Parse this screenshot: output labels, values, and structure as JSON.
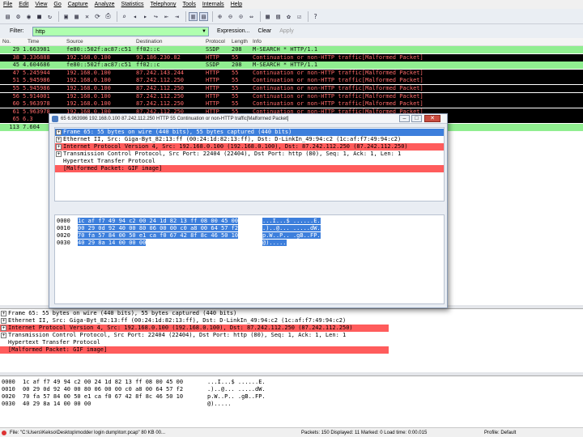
{
  "menu": [
    "File",
    "Edit",
    "View",
    "Go",
    "Capture",
    "Analyze",
    "Statistics",
    "Telephony",
    "Tools",
    "Internals",
    "Help"
  ],
  "toolbar_icons": [
    "interface-list-icon",
    "capture-options-icon",
    "start-capture-icon",
    "stop-capture-icon",
    "restart-capture-icon",
    "sep",
    "open-file-icon",
    "save-file-icon",
    "close-file-icon",
    "reload-icon",
    "print-icon",
    "sep",
    "find-icon",
    "go-back-icon",
    "go-forward-icon",
    "go-to-packet-icon",
    "first-packet-icon",
    "last-packet-icon",
    "sep",
    "colorize-icon",
    "auto-scroll-icon",
    "sep",
    "zoom-in-icon",
    "zoom-out-icon",
    "zoom-normal-icon",
    "resize-columns-icon",
    "sep",
    "capture-filters-icon",
    "display-filters-icon",
    "coloring-rules-icon",
    "preferences-icon",
    "sep",
    "help-icon"
  ],
  "filter": {
    "label": "Filter:",
    "value": "http",
    "expression_label": "Expression...",
    "clear_label": "Clear",
    "apply_label": "Apply"
  },
  "columns": [
    "No.",
    "Time",
    "Source",
    "Destination",
    "Protocol",
    "Length",
    "Info"
  ],
  "packets": [
    {
      "no": "29",
      "time": "1.663981",
      "src": "fe80::502f:ac87:c51",
      "dst": "ff02::c",
      "proto": "SSDP",
      "len": "208",
      "info": "M-SEARCH * HTTP/1.1",
      "style": "green"
    },
    {
      "no": "38",
      "time": "3.336888",
      "src": "192.168.0.100",
      "dst": "93.186.230.82",
      "proto": "HTTP",
      "len": "55",
      "info": "Continuation or non-HTTP traffic[Malformed Packet]",
      "style": "black"
    },
    {
      "no": "45",
      "time": "4.604686",
      "src": "fe80::502f:ac87:c51",
      "dst": "ff02::c",
      "proto": "SSDP",
      "len": "208",
      "info": "M-SEARCH * HTTP/1.1",
      "style": "green"
    },
    {
      "no": "47",
      "time": "5.245944",
      "src": "192.168.0.100",
      "dst": "87.242.143.244",
      "proto": "HTTP",
      "len": "55",
      "info": "Continuation or non-HTTP traffic[Malformed Packet]",
      "style": "black"
    },
    {
      "no": "51",
      "time": "5.945986",
      "src": "192.168.0.100",
      "dst": "87.242.112.250",
      "proto": "HTTP",
      "len": "55",
      "info": "Continuation or non-HTTP traffic[Malformed Packet]",
      "style": "black"
    },
    {
      "no": "55",
      "time": "5.945986",
      "src": "192.168.0.100",
      "dst": "87.242.112.250",
      "proto": "HTTP",
      "len": "55",
      "info": "Continuation or non-HTTP traffic[Malformed Packet]",
      "style": "black"
    },
    {
      "no": "56",
      "time": "5.914001",
      "src": "192.168.0.100",
      "dst": "87.242.112.250",
      "proto": "HTTP",
      "len": "55",
      "info": "Continuation or non-HTTP traffic[Malformed Packet]",
      "style": "black"
    },
    {
      "no": "60",
      "time": "5.963978",
      "src": "192.168.0.100",
      "dst": "87.242.112.250",
      "proto": "HTTP",
      "len": "55",
      "info": "Continuation or non-HTTP traffic[Malformed Packet]",
      "style": "black"
    },
    {
      "no": "61",
      "time": "5.963978",
      "src": "192.168.0.100",
      "dst": "87.242.112.250",
      "proto": "HTTP",
      "len": "55",
      "info": "Continuation or non-HTTP traffic[Malformed Packet]",
      "style": "black"
    },
    {
      "no": "65",
      "time": "6.3",
      "src": "",
      "dst": "",
      "proto": "",
      "len": "",
      "info": "",
      "style": "black"
    },
    {
      "no": "113",
      "time": "7.604",
      "src": "",
      "dst": "",
      "proto": "",
      "len": "",
      "info": "",
      "style": "green"
    }
  ],
  "dialog": {
    "title": "65 6.963986 192.168.0.100 87.242.112.250 HTTP 55 Continuation or non-HTTP traffic[Malformed Packet]",
    "min_label": "–",
    "max_label": "□",
    "close_label": "✕",
    "tree": [
      {
        "text": "Frame 65: 55 bytes on wire (440 bits), 55 bytes captured (440 bits)",
        "style": "sel",
        "exp": "+"
      },
      {
        "text": "Ethernet II, Src: Giga-Byt_82:13:ff (00:24:1d:82:13:ff), Dst: D-LinkIn_49:94:c2 (1c:af:f7:49:94:c2)",
        "style": "",
        "exp": "+"
      },
      {
        "text": "Internet Protocol Version 4, Src: 192.168.0.100 (192.168.0.100), Dst: 87.242.112.250 (87.242.112.250)",
        "style": "err",
        "exp": "+"
      },
      {
        "text": "Transmission Control Protocol, Src Port: 22404 (22404), Dst Port: http (80), Seq: 1, Ack: 1, Len: 1",
        "style": "",
        "exp": "+"
      },
      {
        "text": "Hypertext Transfer Protocol",
        "style": "",
        "exp": ""
      },
      {
        "text": "[Malformed Packet: GIF image]",
        "style": "err",
        "exp": ""
      }
    ],
    "hex": [
      {
        "off": "0000",
        "bytes": "1c af f7 49 94 c2 00 24  1d 82 13 ff 08 00 45 00",
        "ascii": "...I...$ ......E."
      },
      {
        "off": "0010",
        "bytes": "00 29 0d 92 40 00 80 06  00 00 c0 a8 00 64 57 f2",
        "ascii": ".)..@... .....dW."
      },
      {
        "off": "0020",
        "bytes": "70 fa 57 84 00 50 e1 ca  f0 67 42 8f 8c 46 50 10",
        "ascii": "p.W..P.. .gB..FP."
      },
      {
        "off": "0030",
        "bytes": "40 29 8a 14 00 00 00",
        "ascii": "@)....."
      }
    ]
  },
  "detail_tree": [
    {
      "text": "Frame 65: 55 bytes on wire (440 bits), 55 bytes captured (440 bits)",
      "style": "",
      "exp": "+"
    },
    {
      "text": "Ethernet II, Src: Giga-Byt_82:13:ff (00:24:1d:82:13:ff), Dst: D-LinkIn_49:94:c2 (1c:af:f7:49:94:c2)",
      "style": "",
      "exp": "+"
    },
    {
      "text": "Internet Protocol Version 4, Src: 192.168.0.100 (192.168.0.100), Dst: 87.242.112.250 (87.242.112.250)",
      "style": "err",
      "exp": "+"
    },
    {
      "text": "Transmission Control Protocol, Src Port: 22404 (22404), Dst Port: http (80), Seq: 1, Ack: 1, Len: 1",
      "style": "",
      "exp": "+"
    },
    {
      "text": "Hypertext Transfer Protocol",
      "style": "",
      "exp": ""
    },
    {
      "text": "[Malformed Packet: GIF image]",
      "style": "err",
      "exp": ""
    }
  ],
  "bytes": [
    {
      "off": "0000",
      "bytes": "1c af f7 49 94 c2 00 24  1d 82 13 ff 08 00 45 00",
      "ascii": "...I...$ ......E."
    },
    {
      "off": "0010",
      "bytes": "00 29 0d 92 40 00 80 06  00 00 c0 a8 00 64 57 f2",
      "ascii": ".)..@... .....dW."
    },
    {
      "off": "0020",
      "bytes": "70 fa 57 84 00 50 e1 ca  f0 67 42 8f 8c 46 50 10",
      "ascii": "p.W..P.. .gB..FP."
    },
    {
      "off": "0030",
      "bytes": "40 29 8a 14 00 00 00",
      "ascii": "@)....."
    }
  ],
  "status": {
    "file": "File: \"C:\\Users\\Kekso\\Desktop\\modder login dump\\torr.pcap\" 80 KB 00...",
    "packets": "Packets: 150 Displayed: 11 Marked: 0 Load time: 0:00.015",
    "profile": "Profile: Default"
  },
  "colors": {
    "green_row": "#90ee90",
    "black_row": "#000000",
    "malformed_text": "#ff6a6a",
    "selected": "#3d7fdc",
    "error_bg": "#ff5c5c",
    "filter_ok": "#afffaf"
  }
}
